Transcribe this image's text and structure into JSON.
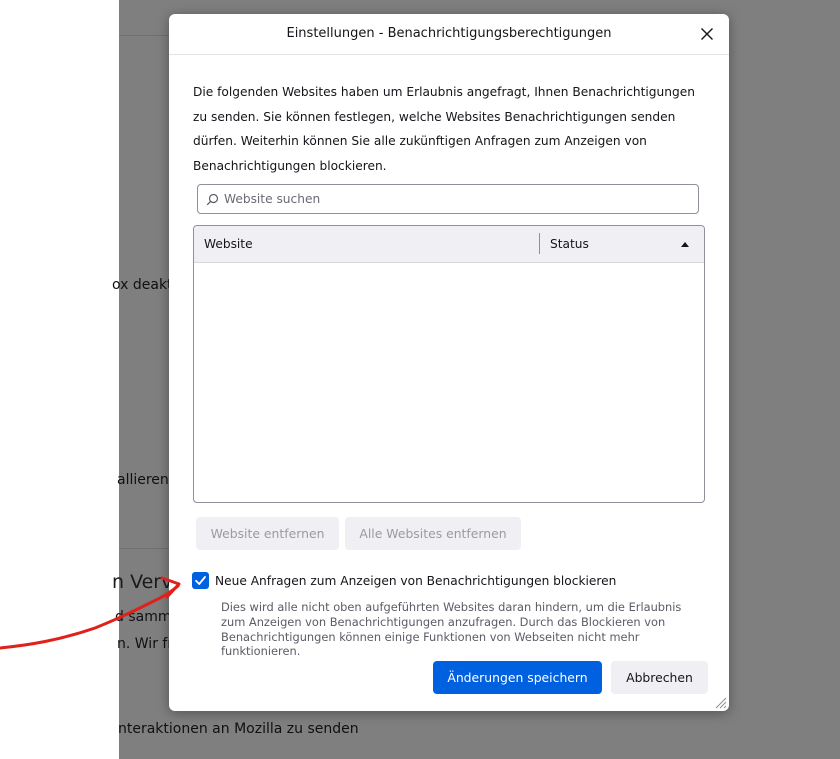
{
  "background": {
    "fragments": [
      "ox deakt",
      "allieren",
      "n Verv",
      "d samm",
      "n. Wir fr",
      "nteraktionen an Mozilla zu senden"
    ]
  },
  "dialog": {
    "title": "Einstellungen - Benachrichtigungsberechtigungen",
    "close_icon": "close-icon",
    "description": "Die folgenden Websites haben um Erlaubnis angefragt, Ihnen Benachrichtigungen zu senden. Sie können festlegen, welche Websites Benachrichtigungen senden dürfen. Weiterhin können Sie alle zukünftigen Anfragen zum Anzeigen von Benachrichtigungen blockieren.",
    "search": {
      "placeholder": "Website suchen",
      "value": "",
      "icon": "search-icon"
    },
    "table": {
      "columns": [
        "Website",
        "Status"
      ],
      "sort_icon": "sort-ascending-icon",
      "rows": []
    },
    "buttons": {
      "remove_website": "Website entfernen",
      "remove_all": "Alle Websites entfernen",
      "save": "Änderungen speichern",
      "cancel": "Abbrechen"
    },
    "block_new_requests": {
      "checked": true,
      "label": "Neue Anfragen zum Anzeigen von Benachrichtigungen blockieren",
      "description": "Dies wird alle nicht oben aufgeführten Websites daran hindern, um die Erlaubnis zum Anzeigen von Benachrichtigungen anzufragen. Durch das Blockieren von Benachrichtigungen können einige Funktionen von Webseiten nicht mehr funktionieren."
    }
  },
  "colors": {
    "accent": "#0061e0",
    "annotation_arrow": "#e0201a",
    "overlay": "#7f7f7f"
  }
}
